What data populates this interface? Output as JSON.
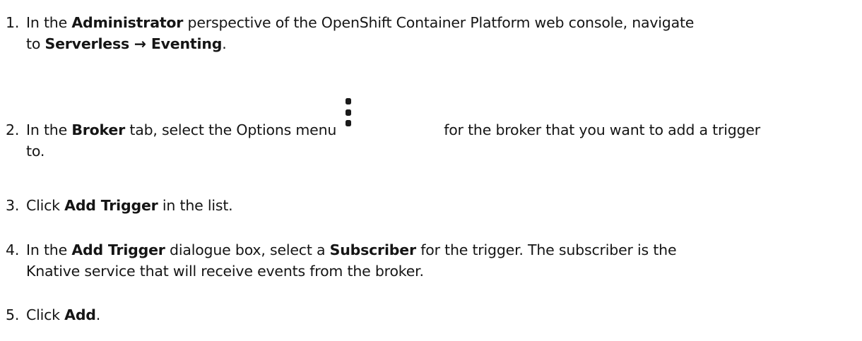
{
  "steps": [
    {
      "number": "1.",
      "t1": "In the ",
      "b1": "Administrator",
      "t2": " perspective of the OpenShift Container Platform web console, navigate",
      "t3": "to ",
      "b2": "Serverless → Eventing",
      "t4": "."
    },
    {
      "number": "2.",
      "t1": "In the ",
      "b1": "Broker",
      "t2": " tab, select the Options menu",
      "icon": "kebab-menu-icon",
      "t3": "for the broker that you want to add a trigger",
      "t4": "to."
    },
    {
      "number": "3.",
      "t1": "Click ",
      "b1": "Add Trigger",
      "t2": " in the list."
    },
    {
      "number": "4.",
      "t1": "In the ",
      "b1": "Add Trigger",
      "t2": " dialogue box, select a ",
      "b2": "Subscriber",
      "t3": " for the trigger. The subscriber is the",
      "t4": "Knative service that will receive events from the broker."
    },
    {
      "number": "5.",
      "t1": "Click ",
      "b1": "Add",
      "t2": "."
    }
  ]
}
